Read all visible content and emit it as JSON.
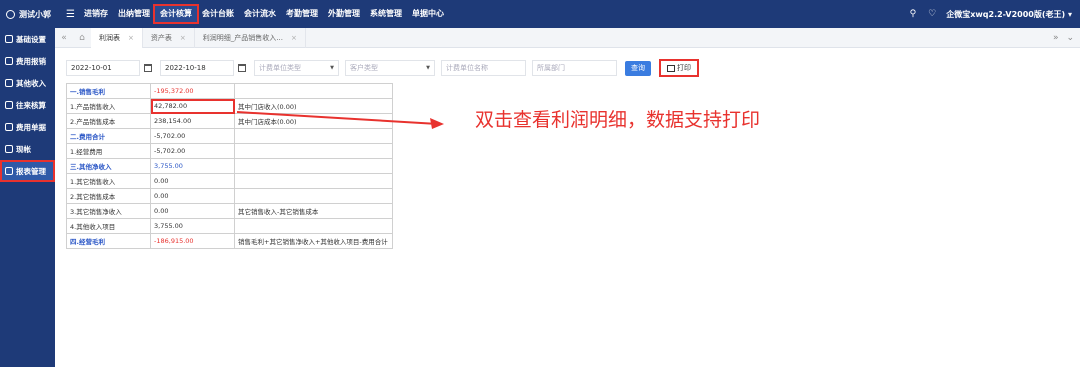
{
  "topbar": {
    "brand": "测试小郭",
    "nav": [
      "进销存",
      "出纳管理",
      "会计核算",
      "会计台账",
      "会计流水",
      "考勤管理",
      "外勤管理",
      "系统管理",
      "单据中心"
    ],
    "active_nav": "会计核算",
    "user": "企微宝xwq2.2-V2000版(老王) ▾"
  },
  "sidebar": {
    "items": [
      "基础设置",
      "费用报销",
      "其他收入",
      "往来核算",
      "费用单据",
      "现帐",
      "报表管理"
    ],
    "active": "报表管理"
  },
  "tabs": {
    "items": [
      {
        "label": "利润表",
        "active": true
      },
      {
        "label": "资产表",
        "active": false
      },
      {
        "label": "利润明细_产品销售收入...",
        "active": false
      }
    ]
  },
  "filters": {
    "start_date": "2022-10-01",
    "end_date": "2022-10-18",
    "unit_type_placeholder": "计费单位类型",
    "customer_type_placeholder": "客户类型",
    "unit_name_placeholder": "计费单位名称",
    "dept_placeholder": "所属部门",
    "query_label": "查询",
    "print_label": "打印"
  },
  "report": {
    "rows": [
      {
        "name": "一.销售毛利",
        "value": "-195,372.00",
        "note": "",
        "section": true,
        "value_color": "red"
      },
      {
        "name": "1.产品销售收入",
        "value": "42,782.00",
        "note": "其中门店收入(0.00)",
        "section": false,
        "highlight": true
      },
      {
        "name": "2.产品销售成本",
        "value": "238,154.00",
        "note": "其中门店成本(0.00)",
        "section": false
      },
      {
        "name": "二.费用合计",
        "value": "-5,702.00",
        "note": "",
        "section": true
      },
      {
        "name": "1.经营费用",
        "value": "-5,702.00",
        "note": "",
        "section": false
      },
      {
        "name": "三.其他净收入",
        "value": "3,755.00",
        "note": "",
        "section": true,
        "value_color": "blue"
      },
      {
        "name": "1.其它销售收入",
        "value": "0.00",
        "note": "",
        "section": false
      },
      {
        "name": "2.其它销售成本",
        "value": "0.00",
        "note": "",
        "section": false
      },
      {
        "name": "3.其它销售净收入",
        "value": "0.00",
        "note": "其它销售收入-其它销售成本",
        "section": false
      },
      {
        "name": "4.其他收入项目",
        "value": "3,755.00",
        "note": "",
        "section": false
      },
      {
        "name": "四.经营毛利",
        "value": "-186,915.00",
        "note": "销售毛利+其它销售净收入+其他收入项目-费用合计",
        "section": true,
        "value_color": "red"
      }
    ]
  },
  "annotation": "双击查看利润明细，数据支持打印",
  "colors": {
    "header_bg": "#1e3a78",
    "highlight_red": "#e8322e",
    "accent_blue": "#2a56c6"
  }
}
